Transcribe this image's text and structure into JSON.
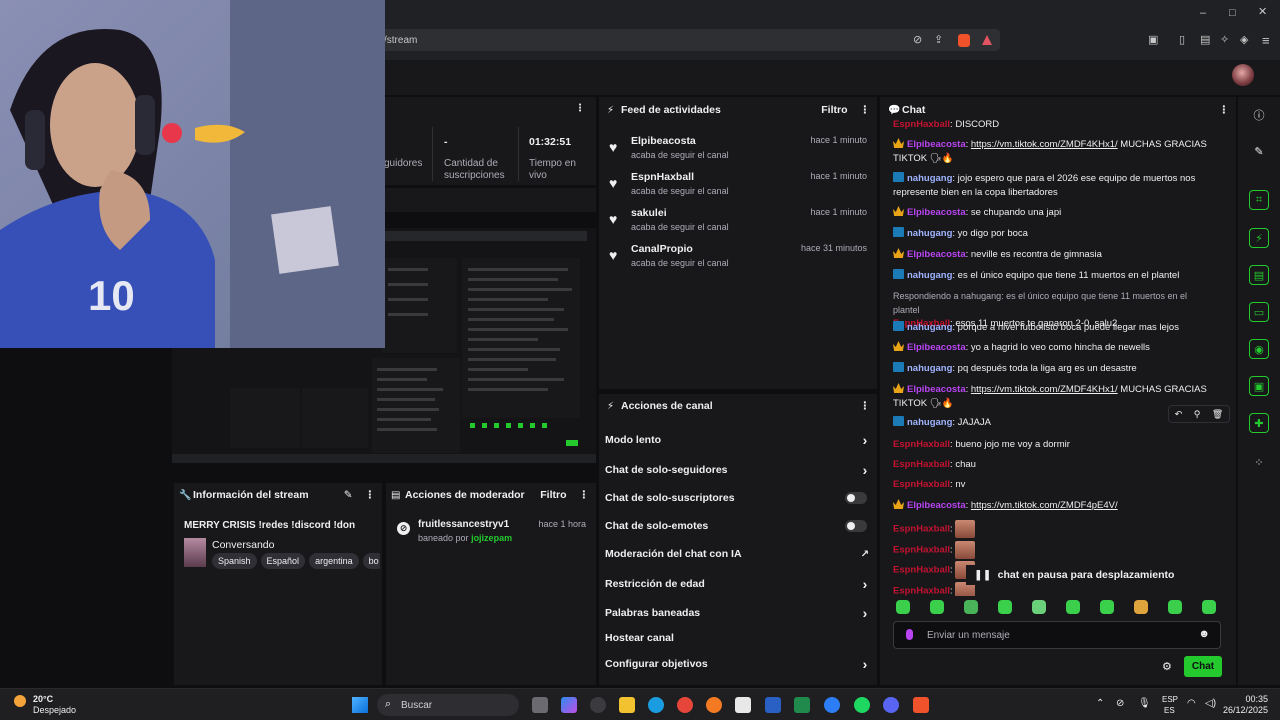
{
  "browser": {
    "url": "/stream"
  },
  "stats": {
    "followers_label": "guidores",
    "subs_value": "-",
    "subs_label_1": "Cantidad de",
    "subs_label_2": "suscripciones",
    "live_value": "01:32:51",
    "live_label_1": "Tiempo en",
    "live_label_2": "vivo"
  },
  "feed": {
    "title": "Feed de actividades",
    "filter": "Filtro",
    "items": [
      {
        "name": "Elpibeacosta",
        "sub": "acaba de seguir el canal",
        "time": "hace 1 minuto"
      },
      {
        "name": "EspnHaxball",
        "sub": "acaba de seguir el canal",
        "time": "hace 1 minuto"
      },
      {
        "name": "sakulei",
        "sub": "acaba de seguir el canal",
        "time": "hace 1 minuto"
      },
      {
        "name": "CanalPropio",
        "sub": "acaba de seguir el canal",
        "time": "hace 31 minutos"
      }
    ]
  },
  "actions": {
    "title": "Acciones de canal",
    "rows": [
      {
        "label": "Modo lento",
        "control": "chevron"
      },
      {
        "label": "Chat de solo-seguidores",
        "control": "chevron"
      },
      {
        "label": "Chat de solo-suscriptores",
        "control": "toggle"
      },
      {
        "label": "Chat de solo-emotes",
        "control": "toggle"
      },
      {
        "label": "Moderación del chat con IA",
        "control": "external"
      },
      {
        "label": "Restricción de edad",
        "control": "chevron"
      },
      {
        "label": "Palabras baneadas",
        "control": "chevron"
      },
      {
        "label": "Hostear canal",
        "control": "none"
      },
      {
        "label": "Configurar objetivos",
        "control": "chevron"
      }
    ]
  },
  "info": {
    "title": "Información del stream",
    "stream_title": "MERRY CRISIS !redes !discord !don",
    "category": "Conversando",
    "tags": [
      "Spanish",
      "Español",
      "argentina",
      "bo"
    ]
  },
  "mod": {
    "title": "Acciones de moderador",
    "filter": "Filtro",
    "user": "fruitlessancestryv1",
    "time": "hace 1 hora",
    "action": "baneado por",
    "by": "jojizepam"
  },
  "chat": {
    "title": "Chat",
    "top_partial": "DISCORD",
    "messages": [
      {
        "badge": "crown",
        "user": "Elpibeacosta",
        "ucolor": "pink",
        "text": "",
        "link": "https://vm.tiktok.com/ZMDF4KHx1/",
        "after": " MUCHAS GRACIAS TIKTOK 🗣🔥"
      },
      {
        "badge": "blue",
        "user": "nahugang",
        "ucolor": "blue",
        "text": "jojo espero que para el 2026 ese equipo de muertos nos represente bien en la copa libertadores"
      },
      {
        "badge": "crown",
        "user": "Elpibeacosta",
        "ucolor": "pink",
        "text": "se chupando una japi"
      },
      {
        "badge": "blue",
        "user": "nahugang",
        "ucolor": "blue",
        "text": "yo digo por boca"
      },
      {
        "badge": "crown",
        "user": "Elpibeacosta",
        "ucolor": "pink",
        "text": "neville es recontra de gimnasia"
      },
      {
        "badge": "blue",
        "user": "nahugang",
        "ucolor": "blue",
        "text": "es el único equipo que tiene 11 muertos en el plantel"
      },
      {
        "reply": "Respondiendo a nahugang: es el único equipo que tiene 11 muertos en el plantel",
        "user": "EspnHaxball",
        "ucolor": "red",
        "text": "esos 11 muertos te ganaron 2-0, salu2."
      },
      {
        "badge": "blue",
        "user": "nahugang",
        "ucolor": "blue",
        "text": "porque a nivel futbolisto boca puede llegar mas lejos"
      },
      {
        "badge": "crown",
        "user": "Elpibeacosta",
        "ucolor": "pink",
        "text": "yo a hagrid lo veo como hincha de newells"
      },
      {
        "badge": "blue",
        "user": "nahugang",
        "ucolor": "blue",
        "text": "pq después toda la liga arg es un desastre"
      },
      {
        "badge": "crown",
        "user": "Elpibeacosta",
        "ucolor": "pink",
        "text": "",
        "link": "https://vm.tiktok.com/ZMDF4KHx1/",
        "after": " MUCHAS GRACIAS TIKTOK 🗣🔥"
      },
      {
        "badge": "blue",
        "user": "nahugang",
        "ucolor": "blue",
        "text": "JAJAJA"
      },
      {
        "user": "EspnHaxball",
        "ucolor": "red",
        "text": "bueno jojo me voy a dormir"
      },
      {
        "user": "EspnHaxball",
        "ucolor": "red",
        "text": "chau"
      },
      {
        "user": "EspnHaxball",
        "ucolor": "red",
        "text": "nv"
      },
      {
        "badge": "crown",
        "user": "Elpibeacosta",
        "ucolor": "pink",
        "text": "",
        "link": "https://vm.tiktok.com/ZMDF4pE4V/",
        "after": ""
      },
      {
        "user": "EspnHaxball",
        "ucolor": "red",
        "emote": true
      },
      {
        "user": "EspnHaxball",
        "ucolor": "red",
        "emote": true
      },
      {
        "user": "EspnHaxball",
        "ucolor": "red",
        "emote": true
      },
      {
        "user": "EspnHaxball",
        "ucolor": "red",
        "emote": true
      }
    ],
    "paused": "chat en pausa para desplazamiento",
    "placeholder": "Enviar un mensaje",
    "send": "Chat"
  },
  "taskbar": {
    "temp": "20°C",
    "weather": "Despejado",
    "search": "Buscar",
    "lang1": "ESP",
    "lang2": "ES",
    "time": "00:35",
    "date": "26/12/2025"
  },
  "colors": {
    "accent": "#23c92d",
    "bg": "#0e0e10",
    "panel": "#18181b"
  }
}
